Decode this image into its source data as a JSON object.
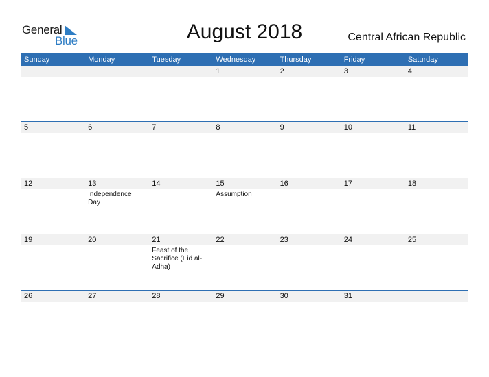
{
  "logo": {
    "word1": "General",
    "word2": "Blue",
    "accent": "#2e7dc4"
  },
  "title": "August 2018",
  "country": "Central African Republic",
  "header_color": "#2e6fb3",
  "weekdays": [
    "Sunday",
    "Monday",
    "Tuesday",
    "Wednesday",
    "Thursday",
    "Friday",
    "Saturday"
  ],
  "weeks": [
    {
      "days": [
        "",
        "",
        "",
        "1",
        "2",
        "3",
        "4"
      ],
      "events": [
        "",
        "",
        "",
        "",
        "",
        "",
        ""
      ]
    },
    {
      "days": [
        "5",
        "6",
        "7",
        "8",
        "9",
        "10",
        "11"
      ],
      "events": [
        "",
        "",
        "",
        "",
        "",
        "",
        ""
      ]
    },
    {
      "days": [
        "12",
        "13",
        "14",
        "15",
        "16",
        "17",
        "18"
      ],
      "events": [
        "",
        "Independence Day",
        "",
        "Assumption",
        "",
        "",
        ""
      ]
    },
    {
      "days": [
        "19",
        "20",
        "21",
        "22",
        "23",
        "24",
        "25"
      ],
      "events": [
        "",
        "",
        "Feast of the Sacrifice (Eid al-Adha)",
        "",
        "",
        "",
        ""
      ]
    },
    {
      "days": [
        "26",
        "27",
        "28",
        "29",
        "30",
        "31",
        ""
      ],
      "events": [
        "",
        "",
        "",
        "",
        "",
        "",
        ""
      ]
    }
  ]
}
